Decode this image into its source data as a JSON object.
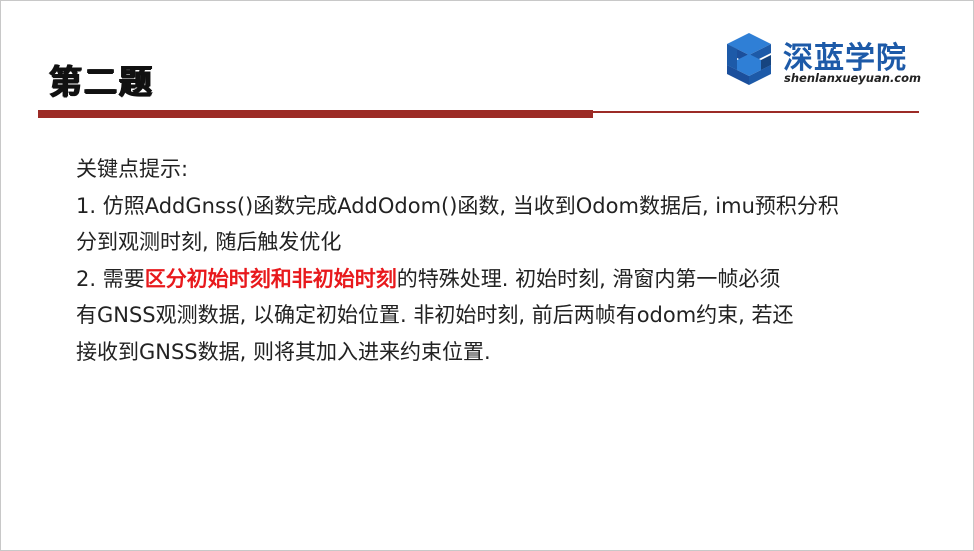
{
  "slide": {
    "title": "第二题",
    "logo": {
      "name": "深蓝学院",
      "url": "shenlanxueyuan.com",
      "icon": "cube-s-logo-icon",
      "brand_color": "#1d5aa8"
    },
    "accent_color": "#9c2b26",
    "highlight_color": "#e8191c",
    "content": {
      "intro": "关键点提示:",
      "item1_line1": "1. 仿照AddGnss()函数完成AddOdom()函数, 当收到Odom数据后, imu预积分积",
      "item1_line2": "分到观测时刻, 随后触发优化",
      "item2_prefix": "2. 需要",
      "item2_highlight": "区分初始时刻和非初始时刻",
      "item2_suffix": "的特殊处理. 初始时刻, 滑窗内第一帧必须",
      "item2_line2": "有GNSS观测数据, 以确定初始位置. 非初始时刻, 前后两帧有odom约束, 若还",
      "item2_line3": "接收到GNSS数据, 则将其加入进来约束位置."
    }
  }
}
